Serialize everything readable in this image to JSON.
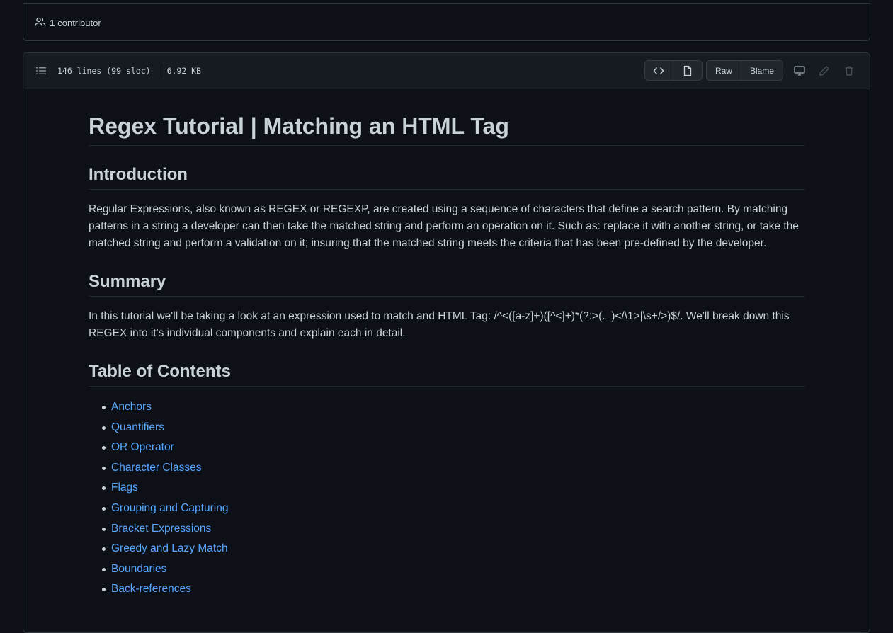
{
  "contributors": {
    "count": "1",
    "label": "contributor"
  },
  "file_header": {
    "lines": "146 lines (99 sloc)",
    "size": "6.92 KB",
    "raw_label": "Raw",
    "blame_label": "Blame",
    "icons": [
      "list-unordered-icon",
      "code-icon",
      "file-icon",
      "device-desktop-icon",
      "pencil-icon",
      "trash-icon"
    ]
  },
  "markdown": {
    "title": "Regex Tutorial | Matching an HTML Tag",
    "intro_heading": "Introduction",
    "intro_text": "Regular Expressions, also known as REGEX or REGEXP, are created using a sequence of characters that define a search pattern. By matching patterns in a string a developer can then take the matched string and perform an operation on it. Such as: replace it with another string, or take the matched string and perform a validation on it; insuring that the matched string meets the criteria that has been pre-defined by the developer.",
    "summary_heading": "Summary",
    "summary_text": "In this tutorial we'll be taking a look at an expression used to match and HTML Tag: /^<([a-z]+)([^<]+)*(?:>(._)</\\1>|\\s+/>)$/. We'll break down this REGEX into it's individual components and explain each in detail.",
    "toc_heading": "Table of Contents",
    "toc": [
      "Anchors",
      "Quantifiers",
      "OR Operator",
      "Character Classes",
      "Flags",
      "Grouping and Capturing",
      "Bracket Expressions",
      "Greedy and Lazy Match",
      "Boundaries",
      "Back-references"
    ]
  },
  "colors": {
    "background": "#0d1117",
    "header_bg": "#161b22",
    "border": "#30363d",
    "text": "#c9d1d9",
    "link": "#58a6ff",
    "muted_icon": "#8b949e"
  }
}
